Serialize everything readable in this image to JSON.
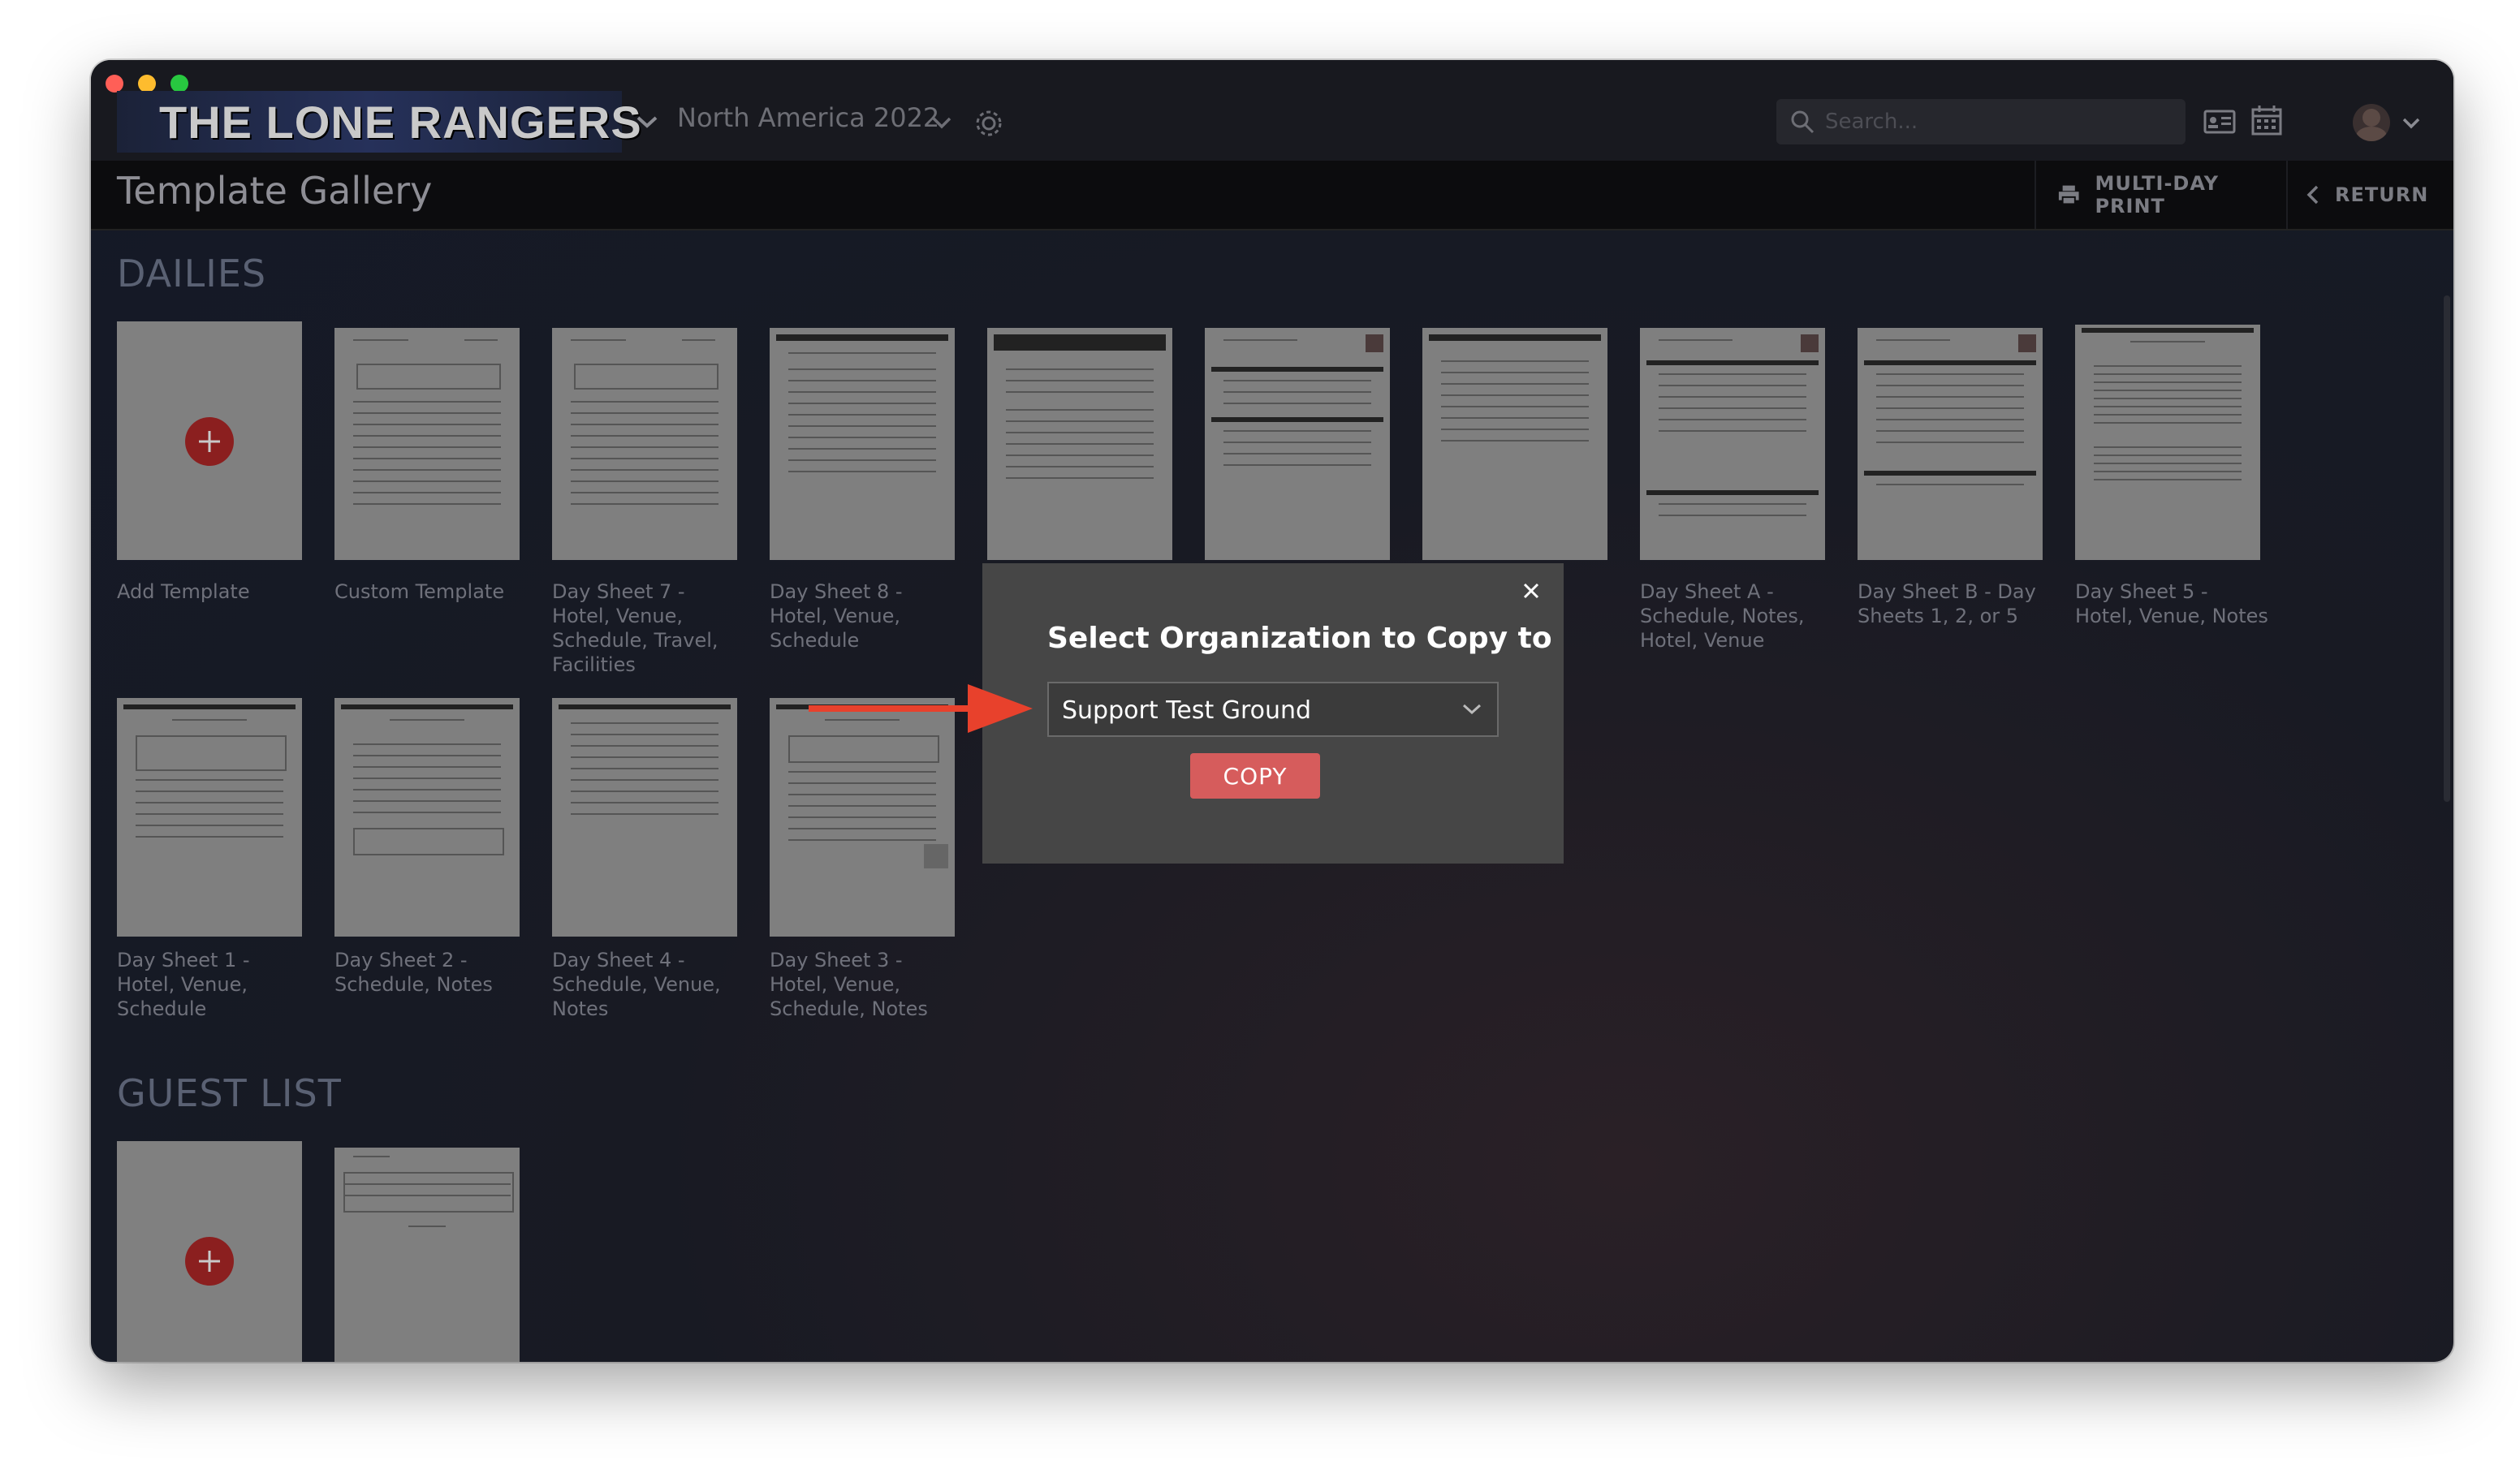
{
  "app": {
    "logo_text": "THE LONE RANGERS",
    "tour_name": "North America 2022",
    "search_placeholder": "Search..."
  },
  "subbar": {
    "page_title": "Template Gallery",
    "multi_day_print_label": "MULTI-DAY PRINT",
    "return_label": "RETURN"
  },
  "sections": {
    "dailies_title": "DAILIES",
    "guest_list_title": "GUEST LIST"
  },
  "dailies_row1": [
    {
      "label": "Add Template"
    },
    {
      "label": "Custom Template"
    },
    {
      "label": "Day Sheet 7 - Hotel, Venue, Schedule, Travel, Facilities"
    },
    {
      "label": "Day Sheet 8 - Hotel, Venue, Schedule"
    },
    {
      "label": ""
    },
    {
      "label": ""
    },
    {
      "label": ""
    },
    {
      "label": "Day Sheet A - Schedule, Notes, Hotel, Venue"
    },
    {
      "label": "Day Sheet B - Day Sheets 1, 2, or 5"
    },
    {
      "label": "Day Sheet 5 - Hotel, Venue, Notes"
    }
  ],
  "dailies_row2": [
    {
      "label": "Day Sheet 1 - Hotel, Venue, Schedule"
    },
    {
      "label": "Day Sheet 2 - Schedule, Notes"
    },
    {
      "label": "Day Sheet 4 - Schedule, Venue, Notes"
    },
    {
      "label": "Day Sheet 3 - Hotel, Venue, Schedule, Notes"
    }
  ],
  "modal": {
    "title": "Select Organization to Copy to",
    "selected_org": "Support Test Ground",
    "copy_label": "COPY"
  },
  "colors": {
    "accent_red": "#d65c5c",
    "plus_red": "#8b1f1f",
    "annotation_arrow": "#e8412c"
  }
}
